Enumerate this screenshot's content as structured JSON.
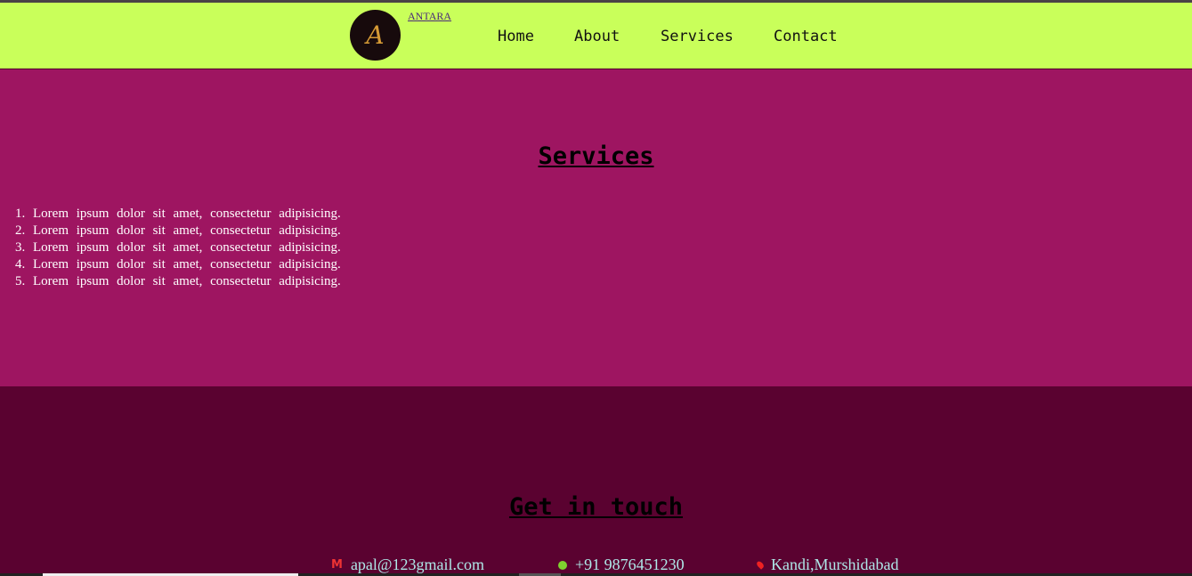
{
  "header": {
    "brand": "ANTARA",
    "logo_letter": "A",
    "nav": [
      "Home",
      "About",
      "Services",
      "Contact"
    ]
  },
  "services": {
    "title": "Services",
    "items": [
      "Lorem ipsum dolor sit amet, consectetur adipisicing.",
      "Lorem ipsum dolor sit amet, consectetur adipisicing.",
      "Lorem ipsum dolor sit amet, consectetur adipisicing.",
      "Lorem ipsum dolor sit amet, consectetur adipisicing.",
      "Lorem ipsum dolor sit amet, consectetur adipisicing."
    ]
  },
  "contact": {
    "title": "Get in touch",
    "email": "apal@123gmail.com",
    "phone": "+91 9876451230",
    "location": "Kandi,Murshidabad"
  },
  "colors": {
    "header": "#c9ff5a",
    "services_bg": "#9e1561",
    "contact_bg": "#5a0230"
  }
}
